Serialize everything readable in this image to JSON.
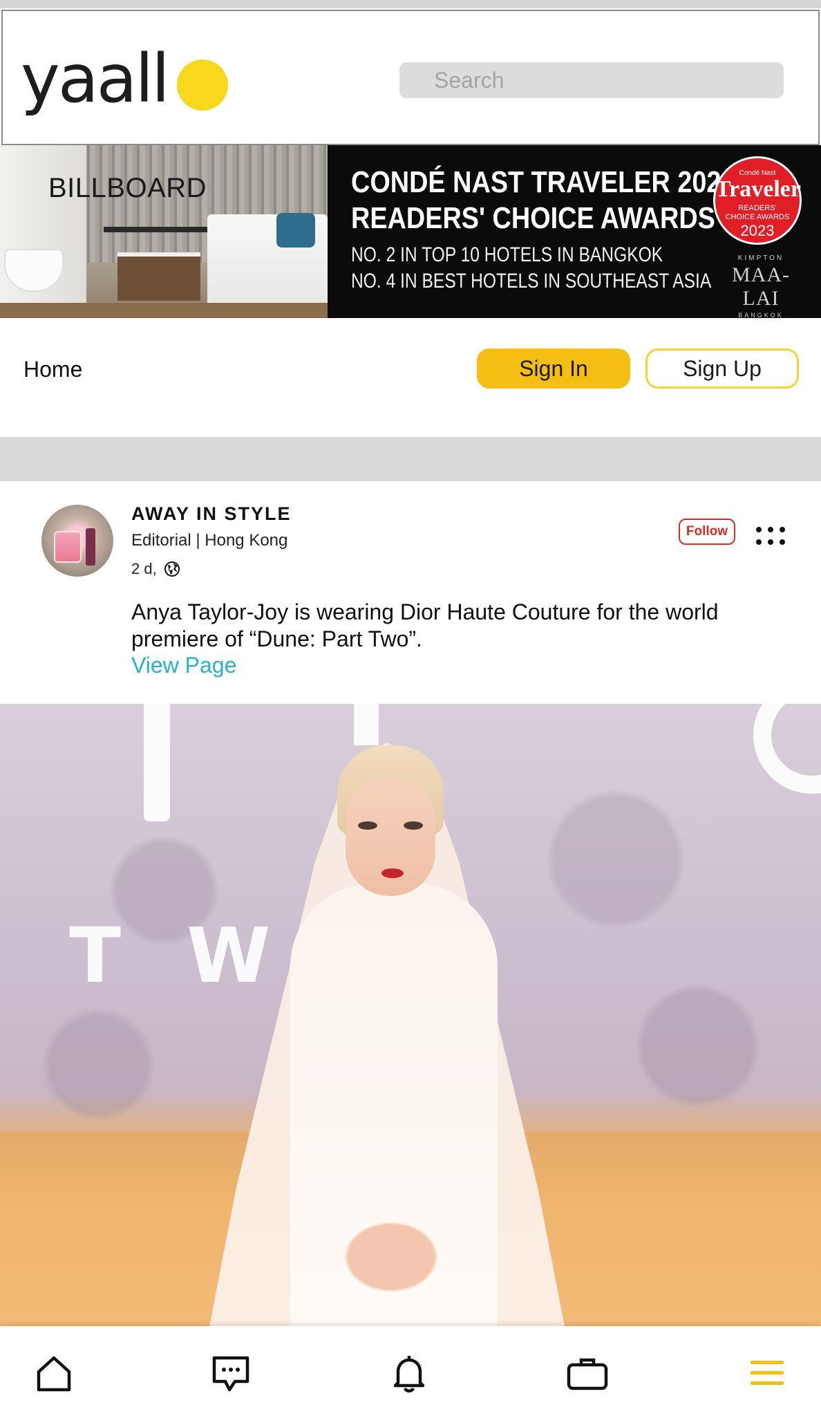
{
  "header": {
    "logo_text": "yaall",
    "search_placeholder": "Search",
    "accent_color": "#f7d81c"
  },
  "billboard": {
    "label": "BILLBOARD",
    "headline_line1": "CONDÉ NAST TRAVELER 2023",
    "headline_line2": "READERS' CHOICE AWARDS",
    "sub_line1": "NO. 2 IN TOP 10 HOTELS IN BANGKOK",
    "sub_line2": "NO. 4 IN BEST HOTELS IN SOUTHEAST ASIA",
    "badge_top": "Condé Nast",
    "badge_brand": "Traveler",
    "badge_line1": "READERS'",
    "badge_line2": "CHOICE AWARDS",
    "badge_year": "2023",
    "hotel_kicker": "KIMPTON",
    "hotel_name": "MAA-LAI",
    "hotel_city": "BANGKOK"
  },
  "nav": {
    "home_label": "Home",
    "signin_label": "Sign In",
    "signup_label": "Sign Up",
    "signin_color": "#f4bf12"
  },
  "post": {
    "author": "AWAY IN STYLE",
    "meta": "Editorial | Hong Kong",
    "time": "2 d,",
    "follow_label": "Follow",
    "text": "Anya Taylor-Joy is wearing Dior Haute Couture for the world premiere of “Dune: Part Two”.",
    "link_label": "View Page",
    "link_color": "#26b3c9",
    "image_letters": [
      "T",
      "W"
    ]
  },
  "bottom_nav": {
    "items": [
      {
        "icon": "home-icon"
      },
      {
        "icon": "chat-icon"
      },
      {
        "icon": "bell-icon"
      },
      {
        "icon": "briefcase-icon"
      },
      {
        "icon": "menu-icon",
        "active_color": "#f4bf12"
      }
    ]
  }
}
